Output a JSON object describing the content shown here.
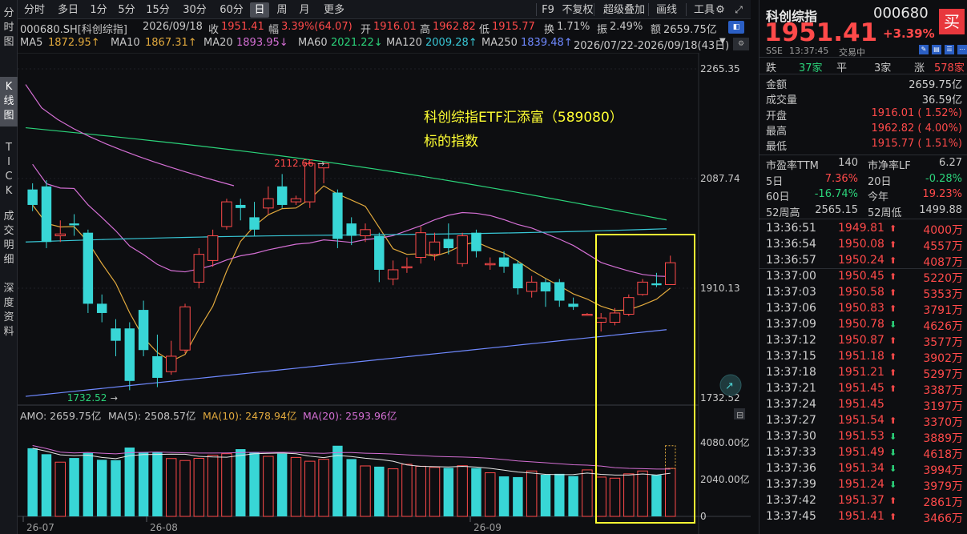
{
  "left_tabs": [
    "分时图",
    "K线图",
    "TICK",
    "成交明细",
    "深度资料"
  ],
  "toolbar": {
    "periods": [
      "分时",
      "多日",
      "1分",
      "5分",
      "15分",
      "30分",
      "60分",
      "日",
      "周",
      "月",
      "更多"
    ],
    "active_period": "日",
    "right_items": [
      "F9",
      "不复权",
      "超级叠加",
      "画线",
      "工具"
    ]
  },
  "info": {
    "code": "000680.SH[科创综指]",
    "date": "2026/09/18",
    "close_label": "收",
    "close": "1951.41",
    "change_label": "幅",
    "change": "3.39%(64.07)",
    "open_label": "开",
    "open": "1916.01",
    "high_label": "高",
    "high": "1962.82",
    "low_label": "低",
    "low": "1915.77",
    "turnover_label": "换",
    "turnover": "1.71%",
    "amplitude_label": "振",
    "amplitude": "2.49%",
    "amount_label": "额",
    "amount": "2659.75亿"
  },
  "ma": {
    "ma5_label": "MA5",
    "ma5": "1872.95↑",
    "ma10_label": "MA10",
    "ma10": "1867.31↑",
    "ma20_label": "MA20",
    "ma20": "1893.95↓",
    "ma60_label": "MA60",
    "ma60": "2021.22↓",
    "ma120_label": "MA120",
    "ma120": "2009.28↑",
    "ma250_label": "MA250",
    "ma250": "1839.48↑",
    "range": "2026/07/22-2026/09/18(43日)"
  },
  "annotation": {
    "line1": "科创综指ETF汇添富（589080）",
    "line2": "标的指数"
  },
  "price_axis": [
    "2265.35",
    "2087.74",
    "1910.13",
    "1732.52"
  ],
  "high_mark": "2112.66",
  "low_mark": "1732.52",
  "vol_header": {
    "amo": "AMO: 2659.75亿",
    "ma5": "MA(5): 2508.57亿",
    "ma10": "MA(10): 2478.94亿",
    "ma20": "MA(20): 2593.96亿"
  },
  "vol_axis": [
    "4080.00亿",
    "2040.00亿",
    "0"
  ],
  "date_axis": [
    "26-07",
    "26-08",
    "26-09"
  ],
  "chart_data": {
    "type": "candlestick",
    "ylim": [
      1732.52,
      2265.35
    ],
    "candles": [
      {
        "o": 2070,
        "c": 2045,
        "h": 2080,
        "l": 2035,
        "v": 3780
      },
      {
        "o": 2075,
        "c": 1985,
        "h": 2085,
        "l": 1975,
        "v": 3450
      },
      {
        "o": 1995,
        "c": 1998,
        "h": 2020,
        "l": 1985,
        "v": 3010
      },
      {
        "o": 2015,
        "c": 2012,
        "h": 2030,
        "l": 1995,
        "v": 3240
      },
      {
        "o": 2000,
        "c": 1885,
        "h": 2005,
        "l": 1870,
        "v": 3520
      },
      {
        "o": 1885,
        "c": 1870,
        "h": 1900,
        "l": 1855,
        "v": 3140
      },
      {
        "o": 1845,
        "c": 1825,
        "h": 1860,
        "l": 1800,
        "v": 3120
      },
      {
        "o": 1845,
        "c": 1760,
        "h": 1855,
        "l": 1745,
        "v": 3820
      },
      {
        "o": 1875,
        "c": 1810,
        "h": 1890,
        "l": 1800,
        "v": 3560
      },
      {
        "o": 1800,
        "c": 1765,
        "h": 1835,
        "l": 1750,
        "v": 3560
      },
      {
        "o": 1775,
        "c": 1800,
        "h": 1825,
        "l": 1770,
        "v": 3210
      },
      {
        "o": 1810,
        "c": 1880,
        "h": 1885,
        "l": 1805,
        "v": 3100
      },
      {
        "o": 1920,
        "c": 1965,
        "h": 1975,
        "l": 1910,
        "v": 3220
      },
      {
        "o": 1955,
        "c": 1995,
        "h": 2005,
        "l": 1945,
        "v": 3390
      },
      {
        "o": 2010,
        "c": 2050,
        "h": 2055,
        "l": 2005,
        "v": 3480
      },
      {
        "o": 2045,
        "c": 2040,
        "h": 2055,
        "l": 2020,
        "v": 3730
      },
      {
        "o": 2025,
        "c": 2005,
        "h": 2050,
        "l": 1995,
        "v": 3560
      },
      {
        "o": 2040,
        "c": 2055,
        "h": 2075,
        "l": 2030,
        "v": 3330
      },
      {
        "o": 2075,
        "c": 2045,
        "h": 2095,
        "l": 2040,
        "v": 3480
      },
      {
        "o": 2050,
        "c": 2055,
        "h": 2060,
        "l": 2045,
        "v": 3270
      },
      {
        "o": 2050,
        "c": 2112,
        "h": 2115,
        "l": 2040,
        "v": 3060
      },
      {
        "o": 2105,
        "c": 2112,
        "h": 2112.66,
        "l": 2080,
        "v": 3170
      },
      {
        "o": 2065,
        "c": 1990,
        "h": 2070,
        "l": 1975,
        "v": 3920
      },
      {
        "o": 2015,
        "c": 1995,
        "h": 2025,
        "l": 1980,
        "v": 3180
      },
      {
        "o": 1995,
        "c": 2005,
        "h": 2015,
        "l": 1985,
        "v": 2800
      },
      {
        "o": 1995,
        "c": 1940,
        "h": 2000,
        "l": 1920,
        "v": 2760
      },
      {
        "o": 1925,
        "c": 1940,
        "h": 1955,
        "l": 1915,
        "v": 2640
      },
      {
        "o": 1945,
        "c": 1945,
        "h": 1960,
        "l": 1935,
        "v": 2890
      },
      {
        "o": 1960,
        "c": 2000,
        "h": 2010,
        "l": 1950,
        "v": 2780
      },
      {
        "o": 1965,
        "c": 1985,
        "h": 2000,
        "l": 1955,
        "v": 2720
      },
      {
        "o": 1990,
        "c": 1975,
        "h": 2015,
        "l": 1965,
        "v": 2690
      },
      {
        "o": 1950,
        "c": 1995,
        "h": 2000,
        "l": 1945,
        "v": 2810
      },
      {
        "o": 2000,
        "c": 1970,
        "h": 2005,
        "l": 1960,
        "v": 2680
      },
      {
        "o": 1950,
        "c": 1950,
        "h": 1960,
        "l": 1940,
        "v": 2420
      },
      {
        "o": 1960,
        "c": 1945,
        "h": 1970,
        "l": 1935,
        "v": 2220
      },
      {
        "o": 1950,
        "c": 1910,
        "h": 1955,
        "l": 1900,
        "v": 2180
      },
      {
        "o": 1905,
        "c": 1920,
        "h": 1930,
        "l": 1895,
        "v": 2520
      },
      {
        "o": 1920,
        "c": 1905,
        "h": 1925,
        "l": 1880,
        "v": 2310
      },
      {
        "o": 1920,
        "c": 1890,
        "h": 1925,
        "l": 1880,
        "v": 2360
      },
      {
        "o": 1885,
        "c": 1880,
        "h": 1895,
        "l": 1875,
        "v": 2240
      },
      {
        "o": 1868,
        "c": 1868,
        "h": 1870,
        "l": 1866,
        "v": 2580
      },
      {
        "o": 1855,
        "c": 1862,
        "h": 1870,
        "l": 1840,
        "v": 2180
      },
      {
        "o": 1855,
        "c": 1870,
        "h": 1878,
        "l": 1850,
        "v": 2120
      },
      {
        "o": 1868,
        "c": 1895,
        "h": 1900,
        "l": 1865,
        "v": 2360
      },
      {
        "o": 1900,
        "c": 1920,
        "h": 1925,
        "l": 1898,
        "v": 2520
      },
      {
        "o": 1918,
        "c": 1915,
        "h": 1935,
        "l": 1912,
        "v": 2300
      },
      {
        "o": 1916.01,
        "c": 1951.41,
        "h": 1962.82,
        "l": 1915.77,
        "v": 2659.75
      }
    ]
  },
  "right_panel": {
    "name": "科创综指",
    "code": "000680",
    "price": "1951.41",
    "change_pct": "+3.39%",
    "buy_label": "买",
    "exchange": "SSE",
    "time": "13:37:45",
    "status": "交易中",
    "breadth": {
      "down_label": "跌",
      "down": "37家",
      "flat_label": "平",
      "flat": "3家",
      "up_label": "涨",
      "up": "578家"
    },
    "stats": [
      {
        "label": "金额",
        "value": "2659.75亿",
        "color": "#d0d0d0"
      },
      {
        "label": "成交量",
        "value": "36.59亿",
        "color": "#d0d0d0"
      },
      {
        "label": "开盘",
        "value": "1916.01 ( 1.52%)",
        "color": "#ff4a4a"
      },
      {
        "label": "最高",
        "value": "1962.82 ( 4.00%)",
        "color": "#ff4a4a"
      },
      {
        "label": "最低",
        "value": "1915.77 ( 1.51%)",
        "color": "#ff4a4a"
      }
    ],
    "pe_label": "市盈率TTM",
    "pe": "140",
    "pb_label": "市净率LF",
    "pb": "6.27",
    "d5_label": "5日",
    "d5": "7.36%",
    "d20_label": "20日",
    "d20": "-0.28%",
    "d60_label": "60日",
    "d60": "-16.74%",
    "ytd_label": "今年",
    "ytd": "19.23%",
    "w52h_label": "52周高",
    "w52h": "2565.15",
    "w52l_label": "52周低",
    "w52l": "1499.88",
    "ticks": [
      {
        "time": "13:36:51",
        "price": "1949.81",
        "dir": "up",
        "vol": "4000万"
      },
      {
        "time": "13:36:54",
        "price": "1950.08",
        "dir": "up",
        "vol": "4557万"
      },
      {
        "time": "13:36:57",
        "price": "1950.24",
        "dir": "up",
        "vol": "4087万"
      },
      {
        "time": "13:37:00",
        "price": "1950.45",
        "dir": "up",
        "vol": "5220万"
      },
      {
        "time": "13:37:03",
        "price": "1950.58",
        "dir": "up",
        "vol": "5353万"
      },
      {
        "time": "13:37:06",
        "price": "1950.83",
        "dir": "up",
        "vol": "3791万"
      },
      {
        "time": "13:37:09",
        "price": "1950.78",
        "dir": "down",
        "vol": "4626万"
      },
      {
        "time": "13:37:12",
        "price": "1950.87",
        "dir": "up",
        "vol": "3577万"
      },
      {
        "time": "13:37:15",
        "price": "1951.18",
        "dir": "up",
        "vol": "3902万"
      },
      {
        "time": "13:37:18",
        "price": "1951.21",
        "dir": "up",
        "vol": "5297万"
      },
      {
        "time": "13:37:21",
        "price": "1951.45",
        "dir": "up",
        "vol": "3387万"
      },
      {
        "time": "13:37:24",
        "price": "1951.45",
        "dir": "flat",
        "vol": "3197万"
      },
      {
        "time": "13:37:27",
        "price": "1951.54",
        "dir": "up",
        "vol": "3370万"
      },
      {
        "time": "13:37:30",
        "price": "1951.53",
        "dir": "down",
        "vol": "3889万"
      },
      {
        "time": "13:37:33",
        "price": "1951.49",
        "dir": "down",
        "vol": "4618万"
      },
      {
        "time": "13:37:36",
        "price": "1951.34",
        "dir": "down",
        "vol": "3994万"
      },
      {
        "time": "13:37:39",
        "price": "1951.24",
        "dir": "down",
        "vol": "3979万"
      },
      {
        "time": "13:37:42",
        "price": "1951.37",
        "dir": "up",
        "vol": "2861万"
      },
      {
        "time": "13:37:45",
        "price": "1951.41",
        "dir": "up",
        "vol": "3466万"
      }
    ]
  }
}
